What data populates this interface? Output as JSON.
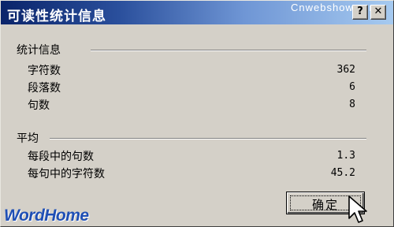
{
  "window": {
    "title": "可读性统计信息",
    "watermark_site": "Cnwebshow.com",
    "help_glyph": "?",
    "close_glyph": "✕"
  },
  "stats": {
    "heading": "统计信息",
    "rows": [
      {
        "label": "字符数",
        "value": "362"
      },
      {
        "label": "段落数",
        "value": "6"
      },
      {
        "label": "句数",
        "value": "8"
      }
    ]
  },
  "averages": {
    "heading": "平均",
    "rows": [
      {
        "label": "每段中的句数",
        "value": "1.3"
      },
      {
        "label": "每句中的字符数",
        "value": "45.2"
      }
    ]
  },
  "buttons": {
    "ok_label": "确定"
  },
  "branding": {
    "logo_text": "WordHome"
  },
  "icons": {
    "help": "help-icon",
    "close": "close-icon",
    "cursor": "arrow-cursor-icon"
  },
  "colors": {
    "dialog_face": "#d4d0c8",
    "titlebar_start": "#0a246a",
    "titlebar_end": "#a6caf0",
    "logo_blue": "#1f4fb5"
  }
}
